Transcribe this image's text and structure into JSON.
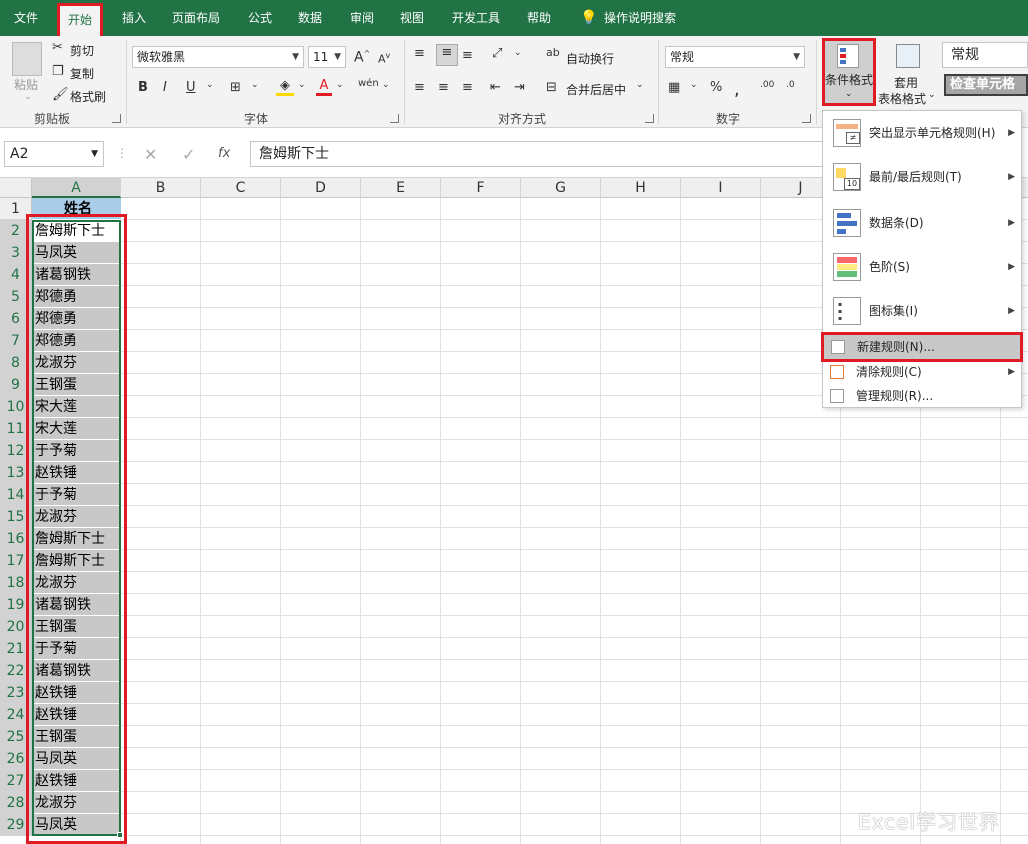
{
  "menu": {
    "tabs": [
      "文件",
      "开始",
      "插入",
      "页面布局",
      "公式",
      "数据",
      "审阅",
      "视图",
      "开发工具",
      "帮助"
    ],
    "tell_me": "操作说明搜索"
  },
  "ribbon": {
    "clipboard": {
      "paste": "粘贴",
      "cut": "剪切",
      "copy": "复制",
      "format_painter": "格式刷",
      "label": "剪贴板"
    },
    "font": {
      "name": "微软雅黑",
      "size": "11",
      "bold": "B",
      "italic": "I",
      "underline": "U",
      "grow": "A",
      "shrink": "A",
      "label": "字体"
    },
    "alignment": {
      "wrap": "自动换行",
      "merge": "合并后居中",
      "label": "对齐方式"
    },
    "number": {
      "format": "常规",
      "label": "数字"
    },
    "styles": {
      "conditional": "条件格式",
      "table_line1": "套用",
      "table_line2": "表格格式",
      "normal": "常规",
      "check_cell": "检查单元格"
    }
  },
  "formula_bar": {
    "name_box": "A2",
    "fx": "fx",
    "content": "詹姆斯下士"
  },
  "columns": [
    "A",
    "B",
    "C",
    "D",
    "E",
    "F",
    "G",
    "H",
    "I",
    "J"
  ],
  "header_cell": "姓名",
  "rows": [
    "詹姆斯下士",
    "马凤英",
    "诸葛钢铁",
    "郑德勇",
    "郑德勇",
    "郑德勇",
    "龙淑芬",
    "王钢蛋",
    "宋大莲",
    "宋大莲",
    "于予菊",
    "赵铁锤",
    "于予菊",
    "龙淑芬",
    "詹姆斯下士",
    "詹姆斯下士",
    "龙淑芬",
    "诸葛钢铁",
    "王钢蛋",
    "于予菊",
    "诸葛钢铁",
    "赵铁锤",
    "赵铁锤",
    "王钢蛋",
    "马凤英",
    "赵铁锤",
    "龙淑芬",
    "马凤英"
  ],
  "row_numbers": [
    "1",
    "2",
    "3",
    "4",
    "5",
    "6",
    "7",
    "8",
    "9",
    "10",
    "11",
    "12",
    "13",
    "14",
    "15",
    "16",
    "17",
    "18",
    "19",
    "20",
    "21",
    "22",
    "23",
    "24",
    "25",
    "26",
    "27",
    "28",
    "29"
  ],
  "dropdown": {
    "highlight": "突出显示单元格规则(H)",
    "topbottom": "最前/最后规则(T)",
    "databars": "数据条(D)",
    "colorscales": "色阶(S)",
    "iconsets": "图标集(I)",
    "new_rule": "新建规则(N)...",
    "clear_rules": "清除规则(C)",
    "manage_rules": "管理规则(R)..."
  },
  "watermark": "Excel学习世界",
  "colors": {
    "excel_green": "#217346",
    "highlight_red": "#e01b24",
    "header_blue": "#a9cde9"
  }
}
